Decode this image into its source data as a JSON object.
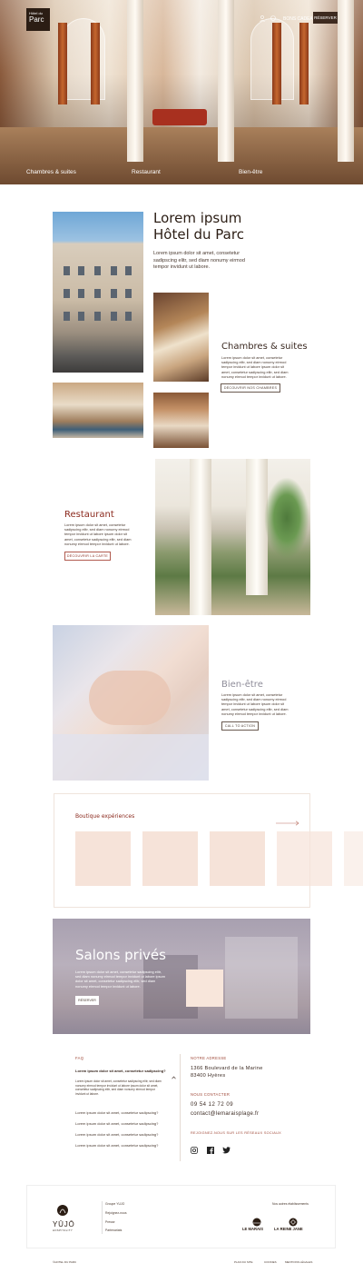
{
  "hero": {
    "logo_line1": "Hôtel du",
    "logo_line2": "Parc",
    "top_links": {
      "gift": "BONS CADEAU",
      "reserve": "RÉSERVER"
    },
    "nav": [
      "Chambres & suites",
      "Restaurant",
      "Bien-être"
    ]
  },
  "intro": {
    "title_line1": "Lorem ipsum",
    "title_line2": "Hôtel du Parc",
    "text": "Lorem ipsum dolor sit amet, consetetur sadipscing elitr, sed diam nonumy eirmod tempor invidunt ut labore."
  },
  "rooms": {
    "title": "Chambres & suites",
    "text": "Lorem ipsum dolor sit amet, consetetur sadipscing elitr, sed diam nonumy eirmod tempor invidunt ut labore ipsum dolor sit amet, consetetur sadipscing elitr, sed diam nonumy eirmod tempor invidunt ut labore.",
    "button": "DÉCOUVRIR NOS CHAMBRES"
  },
  "restaurant": {
    "title": "Restaurant",
    "text": "Lorem ipsum dolor sit amet, consetetur sadipscing elitr, sed diam nonumy eirmod tempor invidunt ut labore ipsum dolor sit amet, consetetur sadipscing elitr, sed diam nonumy eirmod tempor invidunt ut labore.",
    "button": "DÉCOUVRIR LA CARTE"
  },
  "wellness": {
    "title": "Bien-être",
    "text": "Lorem ipsum dolor sit amet, consetetur sadipscing elitr, sed diam nonumy eirmod tempor invidunt ut labore ipsum dolor sit amet, consetetur sadipscing elitr, sed diam nonumy eirmod tempor invidunt ut labore.",
    "button": "CALL TO ACTION"
  },
  "boutique": {
    "title": "Boutique expériences"
  },
  "salons": {
    "title": "Salons privés",
    "text": "Lorem ipsum dolor sit amet, consetetur sadipscing elitr, sed diam nonumy eirmod tempor invidunt ut labore ipsum dolor sit amet, consetetur sadipscing elitr, sed diam nonumy eirmod tempor invidunt ut labore.",
    "button": "RÉSERVER"
  },
  "faq": {
    "heading": "FAQ",
    "question_open": "Lorem ipsum dolor sit amet, consetetur sadipscing?",
    "answer": "Lorem ipsum dolor sit amet, consetetur sadipscing elitr, sed diam nonumy eirmod tempor invidunt ut labore ipsum dolor sit amet, consetetur sadipscing elitr, sed diam nonumy eirmod tempor invidunt ut labore.",
    "questions": [
      "Lorem ipsum dolor sit amet, consetetur sadipscing?",
      "Lorem ipsum dolor sit amet, consetetur sadipscing?",
      "Lorem ipsum dolor sit amet, consetetur sadipscing?",
      "Lorem ipsum dolor sit amet, consetetur sadipscing?"
    ]
  },
  "contact": {
    "address_heading": "NOTRE ADRESSE",
    "address_line1": "1366 Boulevard de la Marine",
    "address_line2": "83400 Hyères",
    "contact_heading": "NOUS CONTACTER",
    "phone": "09 54 12 72 09",
    "email": "contact@lemaraisplage.fr",
    "social_heading": "REJOIGNEZ-NOUS SUR LES RÉSEAUX SOCIAUX"
  },
  "footer": {
    "brand": "YŪJŌ",
    "brand_sub": "HOSPITALITY",
    "links": [
      "Groupe YUJO",
      "Rejoignez-nous",
      "Presse",
      "Partenariats"
    ],
    "other_label": "Nos autres établissements",
    "brand_a": "LE MARAIS",
    "brand_b": "LA REINE JANE",
    "copyright": "©HOTEL DU PARC",
    "bottom_links": [
      "PLAN DU SITE",
      "COOKIES",
      "MENTIONS LÉGALES"
    ]
  }
}
